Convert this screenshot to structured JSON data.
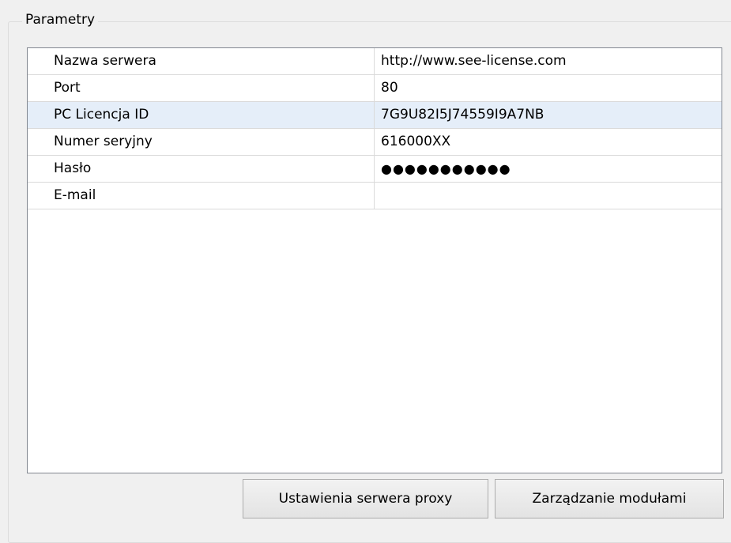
{
  "group": {
    "title": "Parametry"
  },
  "table": {
    "rows": [
      {
        "name": "Nazwa serwera",
        "value": "http://www.see-license.com"
      },
      {
        "name": "Port",
        "value": "80"
      },
      {
        "name": "PC Licencja ID",
        "value": "7G9U82I5J74559I9A7NB"
      },
      {
        "name": "Numer seryjny",
        "value": "616000XX"
      },
      {
        "name": "Hasło",
        "value": "●●●●●●●●●●●"
      },
      {
        "name": "E-mail",
        "value": ""
      }
    ],
    "selected_row": 2
  },
  "buttons": {
    "proxy_label": "Ustawienia serwera proxy",
    "modules_label": "Zarządzanie modułami"
  },
  "colors": {
    "selection": "#e5eef9",
    "grid_border": "#828790",
    "window_bg": "#f0f0f0"
  }
}
